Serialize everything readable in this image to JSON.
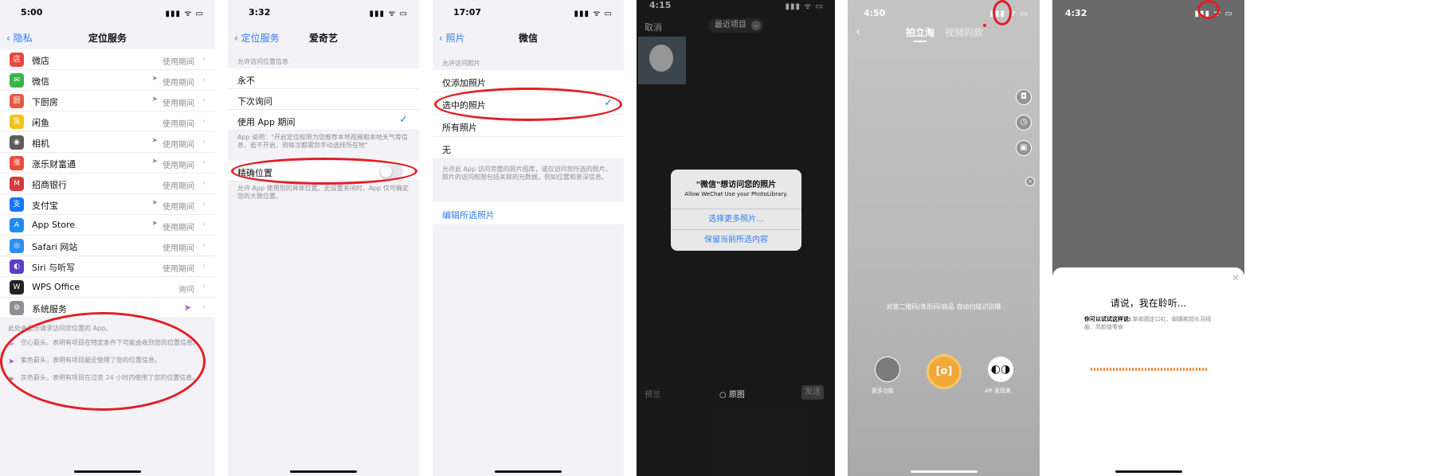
{
  "colors": {
    "ios_blue": "#2f7cf6",
    "highlight_red": "#e31e24",
    "purple_arrow": "#9b59e0"
  },
  "phone1": {
    "time": "5:00",
    "back": "隐私",
    "title": "定位服务",
    "rows": [
      {
        "label": "微店",
        "value": "使用期间",
        "arrow": false,
        "icon": "store-icon",
        "icon_glyph": "店",
        "icon_color": "#e64a3c"
      },
      {
        "label": "微信",
        "value": "使用期间",
        "arrow": true,
        "icon": "wechat-icon",
        "icon_glyph": "✉",
        "icon_color": "#37b54a"
      },
      {
        "label": "下厨房",
        "value": "使用期间",
        "arrow": true,
        "icon": "kitchen-icon",
        "icon_glyph": "厨",
        "icon_color": "#e55a43"
      },
      {
        "label": "闲鱼",
        "value": "使用期间",
        "arrow": false,
        "icon": "fish-icon",
        "icon_glyph": "鱼",
        "icon_color": "#f3c316"
      },
      {
        "label": "相机",
        "value": "使用期间",
        "arrow": true,
        "icon": "camera-icon",
        "icon_glyph": "◉",
        "icon_color": "#5c5c5c"
      },
      {
        "label": "涨乐财富通",
        "value": "使用期间",
        "arrow": true,
        "icon": "finance-icon",
        "icon_glyph": "涨",
        "icon_color": "#e84c3d"
      },
      {
        "label": "招商银行",
        "value": "使用期间",
        "arrow": false,
        "icon": "bank-icon",
        "icon_glyph": "M",
        "icon_color": "#d73b3b"
      },
      {
        "label": "支付宝",
        "value": "使用期间",
        "arrow": true,
        "icon": "alipay-icon",
        "icon_glyph": "支",
        "icon_color": "#1677ff"
      },
      {
        "label": "App Store",
        "value": "使用期间",
        "arrow": true,
        "icon": "appstore-icon",
        "icon_glyph": "A",
        "icon_color": "#1c8df5"
      },
      {
        "label": "Safari 网站",
        "value": "使用期间",
        "arrow": false,
        "icon": "safari-icon",
        "icon_glyph": "◎",
        "icon_color": "#2b8ef0"
      },
      {
        "label": "Siri 与听写",
        "value": "使用期间",
        "arrow": false,
        "icon": "siri-icon",
        "icon_glyph": "◐",
        "icon_color": "#5b3ec8"
      },
      {
        "label": "WPS Office",
        "value": "询问",
        "arrow": false,
        "icon": "wps-icon",
        "icon_glyph": "W",
        "icon_color": "#222222"
      },
      {
        "label": "系统服务",
        "value": "",
        "arrow": false,
        "purple": true,
        "icon": "gear-icon",
        "icon_glyph": "⚙",
        "icon_color": "#8e8e93"
      }
    ],
    "footer": "此处会显示请求访问您位置的 App。",
    "legend": [
      {
        "icon": "hollow-arrow-icon",
        "glyph": "➢",
        "color": "#9b59e0",
        "text": "空心箭头，表明有项目在特定条件下可能会收到您的位置信息。"
      },
      {
        "icon": "purple-arrow-icon",
        "glyph": "➤",
        "color": "#9b59e0",
        "text": "紫色箭头，表明有项目最近使用了您的位置信息。"
      },
      {
        "icon": "gray-arrow-icon",
        "glyph": "➤",
        "color": "#8e8e93",
        "text": "灰色箭头，表明有项目在过去 24 小时内使用了您的位置信息。"
      }
    ]
  },
  "phone2": {
    "time": "3:32",
    "back": "定位服务",
    "title": "爱奇艺",
    "section_header": "允许访问位置信息",
    "options": [
      {
        "label": "永不",
        "checked": false
      },
      {
        "label": "下次询问",
        "checked": false
      },
      {
        "label": "使用 App 期间",
        "checked": true
      }
    ],
    "note": "App 说明：\"开启定位权限为您推荐本地视频和本地天气等信息，若不开启，则每次都需您手动选择所在地\"",
    "precise_label": "精确位置",
    "precise_on": false,
    "precise_note": "允许 App 使用您的具体位置。此设置关闭时，App 仅可确定您的大致位置。"
  },
  "phone3": {
    "time": "17:07",
    "back": "照片",
    "title": "微信",
    "section_header": "允许访问照片",
    "options": [
      {
        "label": "仅添加照片",
        "checked": false
      },
      {
        "label": "选中的照片",
        "checked": true
      },
      {
        "label": "所有照片",
        "checked": false
      },
      {
        "label": "无",
        "checked": false
      }
    ],
    "note": "允许此 App 访问完整的照片图库，或仅访问您所选的照片。照片的访问权限包括关联的元数据，例如位置和景深信息。",
    "edit_link": "编辑所选照片"
  },
  "phone4": {
    "time": "4:15",
    "cancel": "取消",
    "album": "最近项目",
    "dialog_title": "\"微信\"想访问您的照片",
    "dialog_subtitle": "Allow WeChat Use your PhotoLibrary.",
    "btn_select_more": "选择更多照片...",
    "btn_keep": "保留当前所选内容",
    "preview": "预览",
    "original": "原图",
    "send": "发送"
  },
  "phone5": {
    "time": "4:50",
    "tab_active": "拍立淘",
    "tab_other": "视频同款",
    "hint": "对准二维码/条形码/商品 自动扫描识别哦",
    "more_label": "更多功能",
    "shutter_label": "[o]",
    "ar_label": "AR 发现美"
  },
  "phone6": {
    "time": "4:32",
    "title": "请说，我在聆听...",
    "prompt_bold": "你可以试试这样说:",
    "prompt_text": "新款圆定口红、脚踝款超长羽绒服、高颜值零食"
  }
}
